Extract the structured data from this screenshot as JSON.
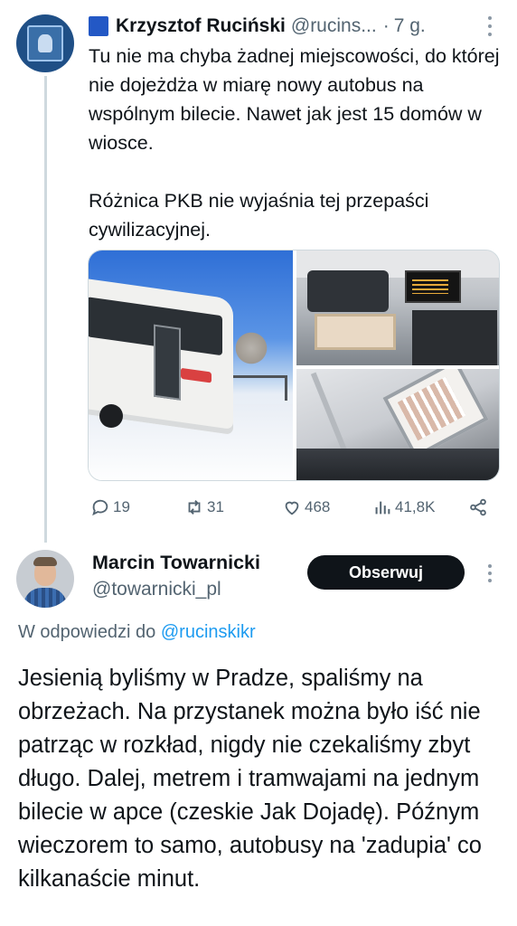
{
  "parent_tweet": {
    "author_name": "Krzysztof Ruciński",
    "author_handle": "@rucins...",
    "separator": "·",
    "time": "7 g.",
    "text_paragraph_1": "Tu nie ma chyba żadnej miejscowości, do której nie dojeżdża w miarę nowy autobus na wspólnym bilecie. Nawet jak jest 15 domów w wiosce.",
    "text_paragraph_2": "Różnica PKB nie wyjaśnia tej przepaści cywilizacyjnej.",
    "flag_color": "#2358c5",
    "actions": {
      "replies": "19",
      "reposts": "31",
      "likes": "468",
      "views": "41,8K"
    }
  },
  "reply_tweet": {
    "author_name": "Marcin Towarnicki",
    "author_handle": "@towarnicki_pl",
    "follow_label": "Obserwuj",
    "in_reply_prefix": "W odpowiedzi do ",
    "in_reply_handle": "@rucinskikr",
    "text": "Jesienią byliśmy w Pradze, spaliśmy na obrzeżach. Na przystanek można było iść nie patrząc w rozkład, nigdy nie czekaliśmy zbyt długo. Dalej, metrem i tramwajami na jednym bilecie w apce (czeskie Jak Dojadę). Późnym wieczorem to samo, autobusy na 'zadupia' co kilkanaście minut."
  },
  "colors": {
    "text": "#0f1419",
    "secondary": "#536471",
    "link": "#1d9bf0",
    "follow_button_bg": "#0f1419"
  }
}
